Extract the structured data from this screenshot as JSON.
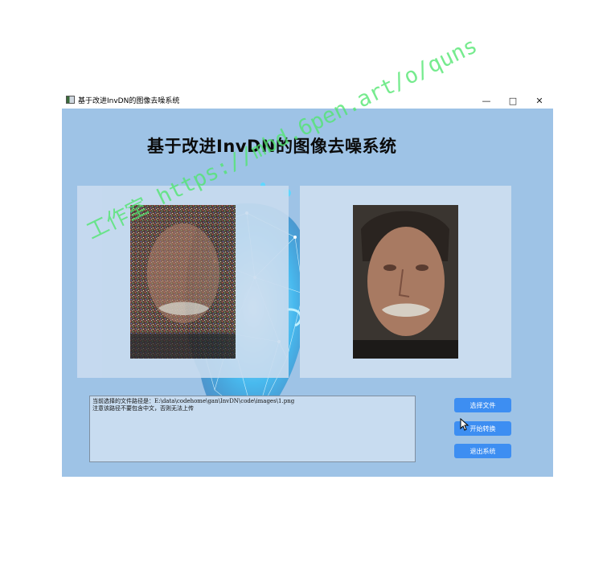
{
  "window": {
    "title": "基于改进InvDN的图像去噪系统",
    "controls": {
      "minimize": "—",
      "maximize": "□",
      "close": "✕"
    }
  },
  "main": {
    "heading": "基于改进InvDN的图像去噪系统"
  },
  "log": {
    "lines": [
      "当前选择的文件路径是：E:\\data\\codehome\\gan\\InvDN\\code\\images\\1.png",
      "注意该路径不要包含中文，否则无法上传"
    ]
  },
  "buttons": {
    "select_file": "选择文件",
    "start_convert": "开始转换",
    "exit_system": "退出系统"
  },
  "watermark": "工作室 https://mbd.6pen.art/o/quns",
  "colors": {
    "client_bg": "#9ec3e6",
    "panel_bg": "#c9dcef",
    "button_bg": "#3d8ef2",
    "watermark": "#50e66e"
  }
}
